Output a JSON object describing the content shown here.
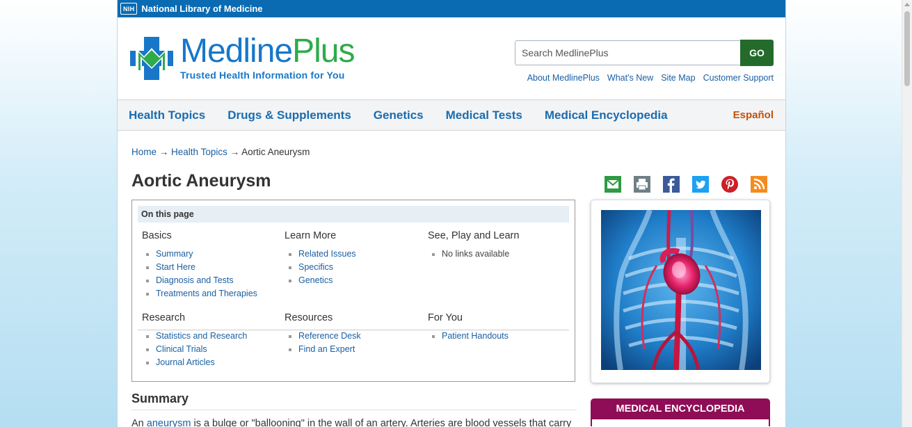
{
  "nlm_bar": {
    "badge": "NIH",
    "label": "National Library of Medicine"
  },
  "logo": {
    "name_part1": "Medline",
    "name_part2": "Plus",
    "tagline": "Trusted Health Information for You"
  },
  "search": {
    "placeholder": "Search MedlinePlus",
    "value": "",
    "button_label": "GO"
  },
  "util_links": [
    "About MedlinePlus",
    "What's New",
    "Site Map",
    "Customer Support"
  ],
  "nav": {
    "items": [
      "Health Topics",
      "Drugs & Supplements",
      "Genetics",
      "Medical Tests",
      "Medical Encyclopedia"
    ],
    "espanol": "Español"
  },
  "breadcrumb": {
    "home": "Home",
    "sep": "→",
    "section": "Health Topics",
    "current": "Aortic Aneurysm"
  },
  "page_title": "Aortic Aneurysm",
  "share_icons": [
    "email-icon",
    "print-icon",
    "facebook-icon",
    "twitter-icon",
    "pinterest-icon",
    "rss-icon"
  ],
  "on_this_page": {
    "heading": "On this page",
    "sections": [
      {
        "title": "Basics",
        "items": [
          "Summary",
          "Start Here",
          "Diagnosis and Tests",
          "Treatments and Therapies"
        ]
      },
      {
        "title": "Learn More",
        "items": [
          "Related Issues",
          "Specifics",
          "Genetics"
        ]
      },
      {
        "title": "See, Play and Learn",
        "items": [
          "No links available"
        ]
      },
      {
        "title": "Research",
        "items": [
          "Statistics and Research",
          "Clinical Trials",
          "Journal Articles"
        ]
      },
      {
        "title": "Resources",
        "items": [
          "Reference Desk",
          "Find an Expert"
        ]
      },
      {
        "title": "For You",
        "items": [
          "Patient Handouts"
        ]
      }
    ]
  },
  "summary": {
    "title": "Summary",
    "text_before": "An ",
    "link": "aneurysm",
    "text_after": " is a bulge or \"ballooning\" in the wall of an artery. Arteries are blood vessels that carry"
  },
  "sidebar": {
    "encyclopedia_label": "MEDICAL ENCYCLOPEDIA"
  },
  "colors": {
    "nlm_blue": "#0a6bb3",
    "logo_blue": "#1877c9",
    "logo_green": "#2eab4b",
    "go_green": "#246b2b",
    "espanol_orange": "#c4520d",
    "encyclopedia_maroon": "#8f0d56"
  }
}
